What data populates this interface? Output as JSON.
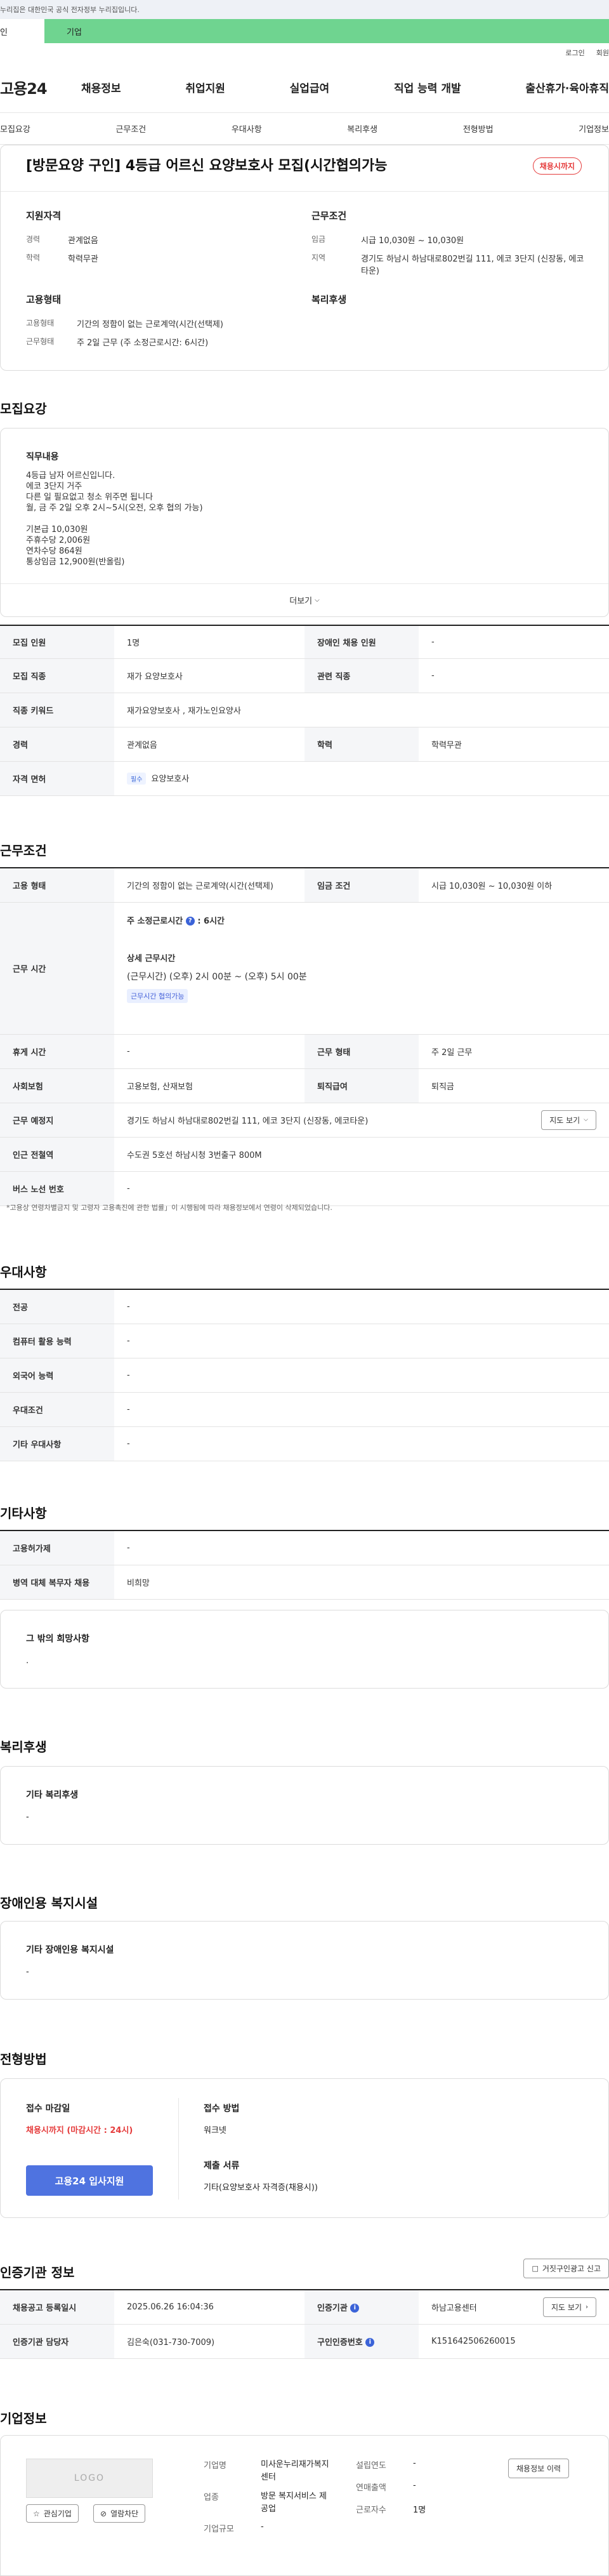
{
  "gov_banner": "누리집은 대한민국 공식 전자정부 누리집입니다.",
  "member_tabs": [
    "인",
    "기업"
  ],
  "util_links": [
    "로그인",
    "회원"
  ],
  "gnb": {
    "logo": "고용24",
    "menus": [
      "채용정보",
      "취업지원",
      "실업급여",
      "직업 능력 개발",
      "출산휴가·육아휴직"
    ]
  },
  "anchor_tabs": [
    "모집요강",
    "근무조건",
    "우대사항",
    "복리후생",
    "전형방법",
    "기업정보"
  ],
  "summary": {
    "title": "[방문요양 구인] 4등급 어르신 요양보호사 모집(시간협의가능",
    "status_badge": "채용시까지",
    "qual_heading": "지원자격",
    "qual": [
      {
        "k": "경력",
        "v": "관계없음"
      },
      {
        "k": "학력",
        "v": "학력무관"
      }
    ],
    "cond_heading": "근무조건",
    "cond": [
      {
        "k": "임금",
        "v": "시급 10,030원 ~ 10,030원"
      },
      {
        "k": "지역",
        "v": "경기도 하남시 하남대로802번길 111, 에코 3단지 (신장동, 에코타운)"
      }
    ],
    "emp_heading": "고용형태",
    "emp": [
      {
        "k": "고용형태",
        "v": "기간의 정함이 없는 근로계약(시간(선택제)"
      },
      {
        "k": "근무형태",
        "v": "주 2일 근무 (주 소정근로시간: 6시간)"
      }
    ],
    "welfare_heading": "복리후생"
  },
  "recruit": {
    "heading": "모집요강",
    "duty_heading": "직무내용",
    "duty_lines": [
      "4등급 남자 어르신입니다.",
      "에코 3단지 거주",
      "다른 일 필요없고 청소 위주면 됩니다",
      "월, 금 주 2일 오후 2시~5시(오전, 오후 협의 가능)",
      "",
      "기본급 10,030원",
      "주휴수당 2,006원",
      "연차수당 864원",
      "통상임금 12,900원(반올림)"
    ],
    "more_label": "더보기",
    "table": [
      [
        "모집 인원",
        "1명",
        "장애인 채용 인원",
        "-"
      ],
      [
        "모집 직종",
        "재가 요양보호사",
        "관련 직종",
        "-"
      ],
      [
        "직종 키워드",
        "재가요양보호사 , 재가노인요양사"
      ],
      [
        "경력",
        "관계없음",
        "학력",
        "학력무관"
      ],
      [
        "자격 면허",
        "요양보호사"
      ]
    ],
    "cert_chip": "필수"
  },
  "work": {
    "heading": "근무조건",
    "emp_type_label": "고용 형태",
    "emp_type": "기간의 정함이 없는 근로계약(시간(선택제)",
    "wage_label": "임금 조건",
    "wage": "시급 10,030원 ~ 10,030원 이하",
    "hours_label": "근무 시간",
    "weekly_hours": "주 소정근로시간",
    "weekly_hours_val": ": 6시간",
    "detail_title": "상세 근무시간",
    "detail": "(근무시간) (오후) 2시 00분 ~ (오후) 5시 00분",
    "detail_chip": "근무시간 협의가능",
    "rest_label": "휴게 시간",
    "rest": "-",
    "form_label": "근무 형태",
    "form": "주 2일 근무",
    "ins_label": "사회보험",
    "ins": "고용보험, 산재보험",
    "retire_label": "퇴직급여",
    "retire": "퇴직금",
    "place_label": "근무 예정지",
    "place": "경기도 하남시 하남대로802번길 111, 에코 3단지 (신장동, 에코타운)",
    "map_btn": "지도 보기",
    "subway_label": "인근 전철역",
    "subway": "수도권 5호선 하남시청 3번출구 800M",
    "bus_label": "버스 노선 번호",
    "bus": "-",
    "note": "*고용상 연령차별금지 및 고령자 고용촉진에 관한 법률」이 시행됨에 따라 채용정보에서 연령이 삭제되었습니다."
  },
  "pref": {
    "heading": "우대사항",
    "rows": [
      [
        "전공",
        "-"
      ],
      [
        "컴퓨터 활용 능력",
        "-"
      ],
      [
        "외국어 능력",
        "-"
      ],
      [
        "우대조건",
        "-"
      ],
      [
        "기타 우대사항",
        "-"
      ]
    ]
  },
  "etc": {
    "heading": "기타사항",
    "rows": [
      [
        "고용허가제",
        "-"
      ],
      [
        "병역 대체 복무자 채용",
        "비희망"
      ]
    ],
    "wish_title": "그 밖의 희망사항",
    "wish_val": "."
  },
  "welfare": {
    "heading": "복리후생",
    "sub": "기타 복리후생",
    "val": "-"
  },
  "disabled": {
    "heading": "장애인용 복지시설",
    "sub": "기타 장애인용 복지시설",
    "val": "-"
  },
  "selection": {
    "heading": "전형방법",
    "deadline_label": "접수 마감일",
    "deadline_val": "채용시까지 (마감시간 : 24시)",
    "apply_btn": "고용24 입사지원",
    "method_label": "접수 방법",
    "method_val": "워크넷",
    "docs_label": "제출 서류",
    "docs_val": "기타(요양보호사 자격증(채용시))"
  },
  "agency": {
    "heading": "인증기관 정보",
    "report_btn": "거짓구인광고 신고",
    "rows": [
      [
        "채용공고 등록일시",
        "2025.06.26 16:04:36",
        "인증기관",
        "하남고용센터"
      ],
      [
        "인증기관 담당자",
        "김은숙(031-730-7009)",
        "구인인증번호",
        "K151642506260015"
      ]
    ],
    "map_btn": "지도 보기"
  },
  "company": {
    "heading": "기업정보",
    "logo_placeholder": "LOGO",
    "fav_btn": "관심기업",
    "block_btn": "열람차단",
    "fields": [
      [
        "기업명",
        "미사운누리재가복지센터"
      ],
      [
        "업종",
        "방문 복지서비스 제공업"
      ],
      [
        "기업규모",
        "-"
      ]
    ],
    "fields2": [
      [
        "설립연도",
        "-"
      ],
      [
        "연매출액",
        "-"
      ],
      [
        "근로자수",
        "1명"
      ]
    ],
    "jobs_btn": "채용정보 이력"
  }
}
